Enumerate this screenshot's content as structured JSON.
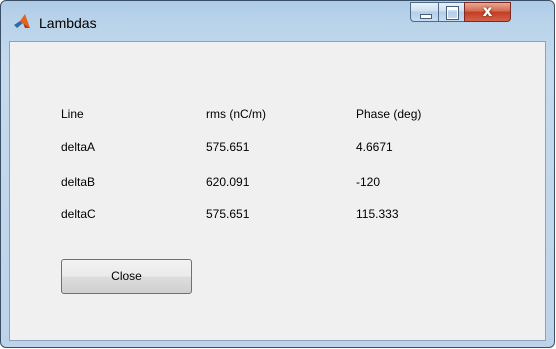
{
  "window": {
    "title": "Lambdas",
    "controls": {
      "minimize": "minimize",
      "maximize": "maximize",
      "close": "x"
    }
  },
  "table": {
    "headers": [
      "Line",
      "rms (nC/m)",
      "Phase (deg)"
    ],
    "rows": [
      [
        "deltaA",
        "575.651",
        "4.6671"
      ],
      [
        "deltaB",
        "620.091",
        "-120"
      ],
      [
        "deltaC",
        "575.651",
        "115.333"
      ]
    ]
  },
  "close_button": {
    "label": "Close"
  },
  "colors": {
    "close_control": "#c43c22",
    "panel_background": "#f0f0f0"
  },
  "icons": {
    "app": "matlab-icon"
  }
}
